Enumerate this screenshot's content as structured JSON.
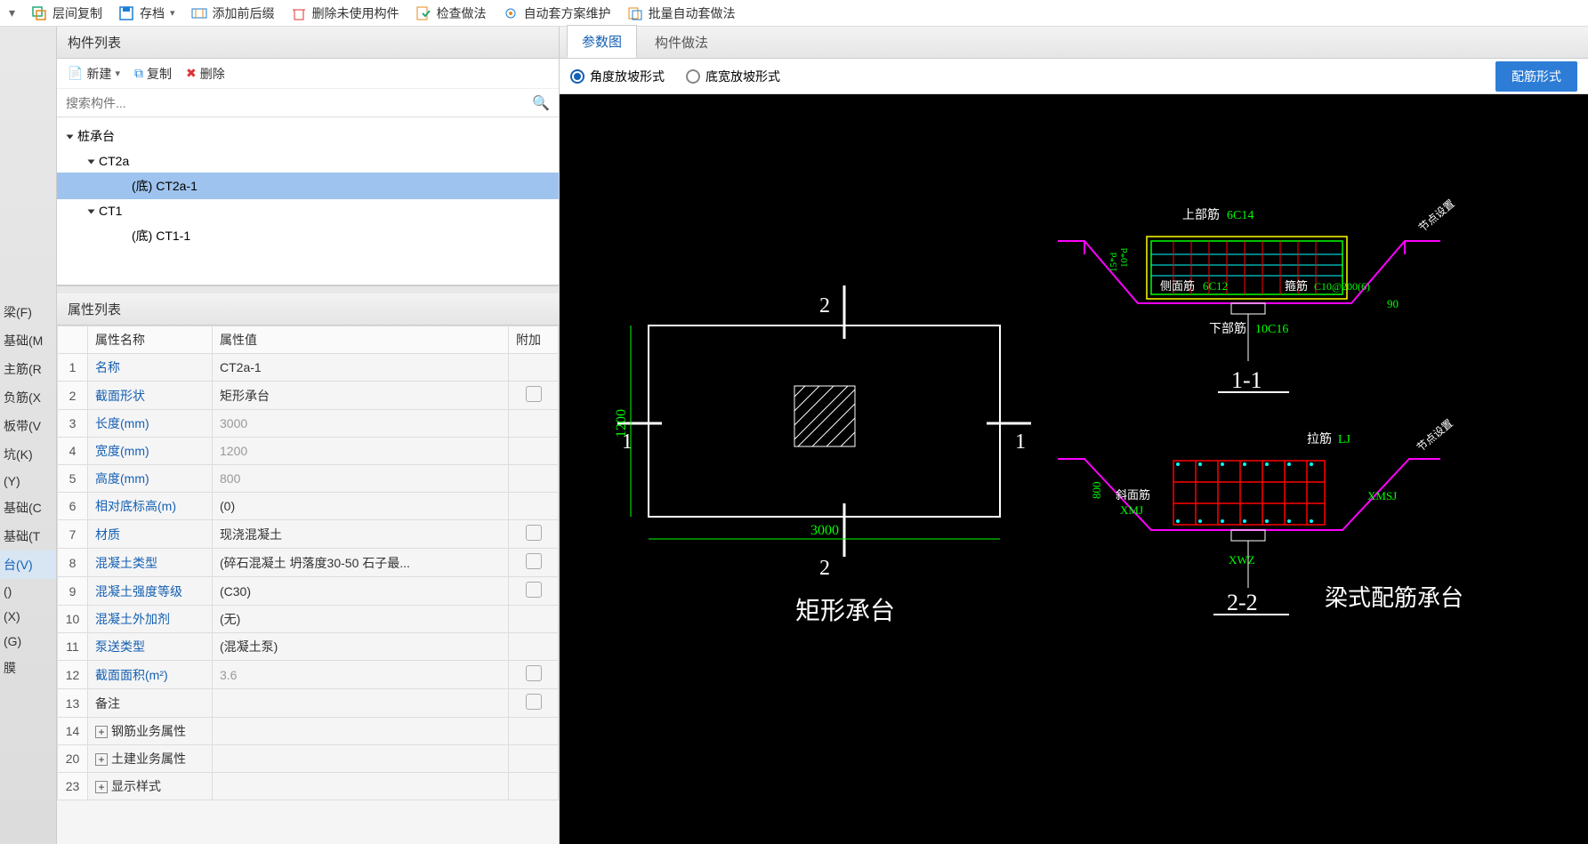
{
  "toolbar": {
    "layer_copy": "层间复制",
    "archive": "存档",
    "add_prefix_suffix": "添加前后缀",
    "delete_unused": "删除未使用构件",
    "check_method": "检查做法",
    "auto_scheme_maintain": "自动套方案维护",
    "batch_auto_method": "批量自动套做法"
  },
  "left_nav": {
    "items": [
      "梁(F)",
      "基础(M",
      "主筋(R",
      "负筋(X",
      "板带(V",
      "坑(K)",
      "(Y)",
      "基础(C",
      "基础(T",
      "台(V)",
      "()",
      "(X)",
      "(G)",
      "膜"
    ],
    "selected_index": 9
  },
  "component_list": {
    "title": "构件列表",
    "btn_new": "新建",
    "btn_copy": "复制",
    "btn_delete": "删除",
    "search_placeholder": "搜索构件...",
    "tree": [
      {
        "level": 0,
        "label": "桩承台",
        "expanded": true
      },
      {
        "level": 1,
        "label": "CT2a",
        "expanded": true
      },
      {
        "level": 2,
        "label": "(底) CT2a-1",
        "selected": true
      },
      {
        "level": 1,
        "label": "CT1",
        "expanded": true
      },
      {
        "level": 2,
        "label": "(底) CT1-1"
      }
    ]
  },
  "props": {
    "title": "属性列表",
    "h_name": "属性名称",
    "h_value": "属性值",
    "h_extra": "附加",
    "rows": [
      {
        "n": "1",
        "name": "名称",
        "val": "CT2a-1",
        "link": true
      },
      {
        "n": "2",
        "name": "截面形状",
        "val": "矩形承台",
        "link": true,
        "chk": true
      },
      {
        "n": "3",
        "name": "长度(mm)",
        "val": "3000",
        "link": true,
        "gray": true
      },
      {
        "n": "4",
        "name": "宽度(mm)",
        "val": "1200",
        "link": true,
        "gray": true
      },
      {
        "n": "5",
        "name": "高度(mm)",
        "val": "800",
        "link": true,
        "gray": true
      },
      {
        "n": "6",
        "name": "相对底标高(m)",
        "val": "(0)",
        "link": true
      },
      {
        "n": "7",
        "name": "材质",
        "val": "现浇混凝土",
        "link": true,
        "chk": true
      },
      {
        "n": "8",
        "name": "混凝土类型",
        "val": "(碎石混凝土 坍落度30-50 石子最...",
        "link": true,
        "chk": true
      },
      {
        "n": "9",
        "name": "混凝土强度等级",
        "val": "(C30)",
        "link": true,
        "chk": true
      },
      {
        "n": "10",
        "name": "混凝土外加剂",
        "val": "(无)",
        "link": true
      },
      {
        "n": "11",
        "name": "泵送类型",
        "val": "(混凝土泵)",
        "link": true
      },
      {
        "n": "12",
        "name": "截面面积(m²)",
        "val": "3.6",
        "link": true,
        "gray": true,
        "chk": true
      },
      {
        "n": "13",
        "name": "备注",
        "val": "",
        "chk": true
      },
      {
        "n": "14",
        "name": "钢筋业务属性",
        "val": "",
        "exp": true
      },
      {
        "n": "20",
        "name": "土建业务属性",
        "val": "",
        "exp": true
      },
      {
        "n": "23",
        "name": "显示样式",
        "val": "",
        "exp": true
      }
    ]
  },
  "right": {
    "tab_param": "参数图",
    "tab_method": "构件做法",
    "radio_angle": "角度放坡形式",
    "radio_width": "底宽放坡形式",
    "btn_rebar_form": "配筋形式"
  },
  "cad": {
    "plan": {
      "title": "矩形承台",
      "w": "3000",
      "h": "1200",
      "n1": "1",
      "n2": "2"
    },
    "sec1": {
      "title": "1-1",
      "top_label": "上部筋",
      "top_val": "6C14",
      "side_label": "侧面筋",
      "side_val": "6C12",
      "stirrup_label": "箍筋",
      "stirrup_val": "C10@200(6)",
      "bot_label": "下部筋",
      "bot_val": "10C16",
      "ang": "90",
      "dim": "10*d",
      "node": "节点设置",
      "dim2": "15*d"
    },
    "sec2": {
      "title": "2-2",
      "tie_label": "拉筋",
      "tie_val": "LJ",
      "xm_label": "斜面筋",
      "xm_val": "XMJ",
      "xmsj": "XMSJ",
      "xwz": "XWZ",
      "h": "800",
      "big_title": "梁式配筋承台",
      "node": "节点设置"
    }
  }
}
